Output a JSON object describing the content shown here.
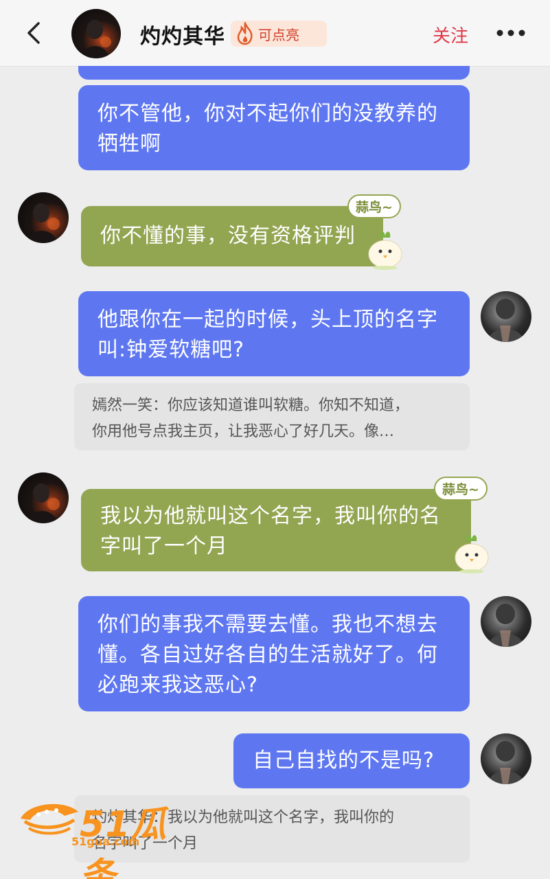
{
  "header": {
    "contact_name": "灼灼其华",
    "badge_label": "可点亮",
    "follow_label": "关注"
  },
  "messages": [
    {
      "side": "right",
      "style": "blue",
      "text_lines": [
        "你不管他，你对不起你们的没教养的",
        "牺牲啊"
      ]
    },
    {
      "side": "left",
      "style": "green",
      "text_lines": [
        "你不懂的事，没有资格评判"
      ],
      "sticker": "蒜鸟~"
    },
    {
      "side": "right",
      "style": "blue",
      "text_lines": [
        "他跟你在一起的时候，头上顶的名字",
        "叫:钟爱软糖吧?"
      ]
    },
    {
      "type": "quote",
      "text_lines": [
        "嫣然一笑：你应该知道谁叫软糖。你知不知道，",
        "你用他号点我主页，让我恶心了好几天。像…"
      ]
    },
    {
      "side": "left",
      "style": "green",
      "text_lines": [
        "我以为他就叫这个名字，我叫你的名",
        "字叫了一个月"
      ],
      "sticker": "蒜鸟~"
    },
    {
      "side": "right",
      "style": "blue",
      "text_lines": [
        "你们的事我不需要去懂。我也不想去",
        "懂。各自过好各自的生活就好了。何",
        "必跑来我这恶心?"
      ]
    },
    {
      "side": "right",
      "style": "blue",
      "text_lines": [
        "自己自找的不是吗?"
      ]
    },
    {
      "type": "quote",
      "text_lines": [
        "灼灼其华：我以为他就叫这个名字，我叫你的",
        "名字叫了一个月"
      ]
    }
  ],
  "watermark": {
    "logo_text": "51瓜条",
    "url_text": "51gua.com"
  },
  "colors": {
    "blue_bubble": "#5e77f1",
    "green_bubble": "#92a551",
    "follow": "#e0384a",
    "watermark": "#f7931e"
  }
}
